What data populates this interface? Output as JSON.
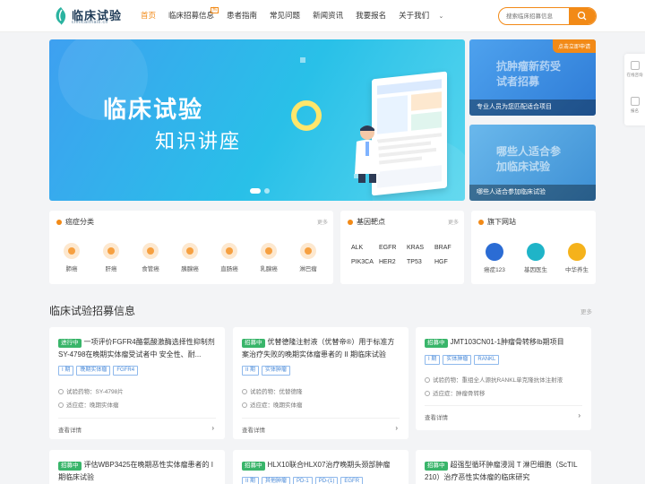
{
  "header": {
    "logo_title": "临床试验",
    "logo_sub": "clinicaltrials.cn",
    "nav": [
      {
        "label": "首页",
        "active": true
      },
      {
        "label": "临床招募信息",
        "hot": "热"
      },
      {
        "label": "患者指南"
      },
      {
        "label": "常见问题"
      },
      {
        "label": "新闻资讯"
      },
      {
        "label": "我要报名"
      },
      {
        "label": "关于我们"
      }
    ],
    "search_placeholder": "搜索临床招募信息"
  },
  "banner": {
    "title": "临床试验",
    "subtitle": "知识讲座"
  },
  "side_cards": [
    {
      "tag": "点击立即申请",
      "headline": "抗肿瘤新药受试者招募",
      "caption": "专业人员为您匹配适合项目"
    },
    {
      "headline": "哪些人适合参加临床试验",
      "caption": "哪些人适合参加临床试验"
    }
  ],
  "float_bar": [
    {
      "label": "在线咨询"
    },
    {
      "label": "报名"
    }
  ],
  "panels": {
    "cancer": {
      "title": "癌症分类",
      "more": "更多",
      "items": [
        "肺癌",
        "肝癌",
        "食管癌",
        "胰腺癌",
        "直肠癌",
        "乳腺癌",
        "淋巴瘤"
      ]
    },
    "gene": {
      "title": "基因靶点",
      "more": "更多",
      "items": [
        "ALK",
        "EGFR",
        "KRAS",
        "BRAF",
        "PIK3CA",
        "HER2",
        "TP53",
        "HGF"
      ]
    },
    "apps": {
      "title": "旗下网站",
      "items": [
        {
          "label": "癌症123",
          "color": "#2b6cd4"
        },
        {
          "label": "基因医生",
          "color": "#1fb4c8"
        },
        {
          "label": "中华养生",
          "color": "#f5b21b"
        }
      ]
    }
  },
  "list": {
    "title": "临床试验招募信息",
    "more": "更多",
    "cards": [
      {
        "status": "进行中",
        "title": "一项评价FGFR4酪氨酸激酶选择性抑制剂SY-4798在晚期实体瘤受试者中 安全性、耐...",
        "tags": [
          "I 期",
          "晚期实体瘤",
          "FGFR4"
        ],
        "drug": "试验药物：SY-4798片",
        "indication": "适应症：晚期实体瘤",
        "foot": "查看详情"
      },
      {
        "status": "招募中",
        "title": "优替德隆注射液（优替帝®）用于标准方案治疗失败的晚期实体瘤患者的 II 期临床试验",
        "tags": [
          "II 期",
          "实体肿瘤"
        ],
        "drug": "试验药物：优替德隆",
        "indication": "适应症：晚期实体瘤",
        "foot": "查看详情"
      },
      {
        "status": "招募中",
        "title": "JMT103CN01-1肿瘤骨转移Ib期项目",
        "tags": [
          "I 期",
          "实体肿瘤",
          "RANKL"
        ],
        "drug": "试验药物：重组全人源抗RANKL单克隆抗体注射液",
        "indication": "适应症：肿瘤骨转移",
        "foot": "查看详情"
      },
      {
        "status": "招募中",
        "title": "评估WBP3425在晚期恶性实体瘤患者的 I 期临床试验"
      },
      {
        "status": "招募中",
        "title": "HLX10联合HLX07治疗晚期头颈部肿瘤",
        "tags": [
          "II 期",
          "其他肿瘤",
          "PD-1",
          "PD-(1)",
          "EGFR"
        ]
      },
      {
        "status": "招募中",
        "title": "超强型循环肿瘤浸润 T 淋巴细胞（ScTIL 210）治疗恶性实体瘤的临床研究"
      }
    ]
  }
}
